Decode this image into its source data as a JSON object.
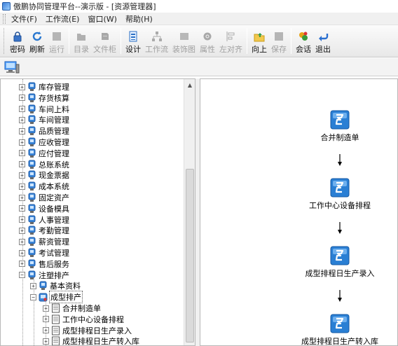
{
  "window": {
    "title": "傲鹏协同管理平台--演示版 - [资源管理器]"
  },
  "menu": {
    "items": [
      "文件(F)",
      "工作流(E)",
      "窗口(W)",
      "帮助(H)"
    ]
  },
  "toolbar": {
    "buttons": [
      {
        "label": "密码",
        "icon": "lock-icon",
        "enabled": true
      },
      {
        "label": "刷新",
        "icon": "refresh-icon",
        "enabled": true
      },
      {
        "label": "运行",
        "icon": "run-icon",
        "enabled": false
      },
      {
        "label": "目录",
        "icon": "folder-icon",
        "enabled": false
      },
      {
        "label": "文件柜",
        "icon": "cabinet-icon",
        "enabled": false
      },
      {
        "label": "设计",
        "icon": "design-icon",
        "enabled": true
      },
      {
        "label": "工作流",
        "icon": "workflow-icon",
        "enabled": false
      },
      {
        "label": "装饰图",
        "icon": "decoration-icon",
        "enabled": false
      },
      {
        "label": "属性",
        "icon": "properties-icon",
        "enabled": false
      },
      {
        "label": "左对齐",
        "icon": "align-left-icon",
        "enabled": false
      },
      {
        "label": "向上",
        "icon": "up-icon",
        "enabled": true
      },
      {
        "label": "保存",
        "icon": "save-icon",
        "enabled": false
      },
      {
        "label": "会话",
        "icon": "chat-icon",
        "enabled": true
      },
      {
        "label": "退出",
        "icon": "exit-icon",
        "enabled": true
      }
    ]
  },
  "tree": {
    "top_items": [
      "库存管理",
      "存货核算",
      "车间上料",
      "车间管理",
      "品质管理",
      "应收管理",
      "应付管理",
      "总账系统",
      "现金票据",
      "成本系统",
      "固定资产",
      "设备模具",
      "人事管理",
      "考勤管理",
      "薪资管理",
      "考试管理",
      "售后服务",
      "注塑排产"
    ],
    "sub_items": [
      "基本资料",
      "成型排产"
    ],
    "leaf_items": [
      "合并制造单",
      "工作中心设备排程",
      "成型排程日生产录入",
      "成型排程日生产转入库"
    ]
  },
  "flow": {
    "nodes": [
      "合并制造单",
      "工作中心设备排程",
      "成型排程日生产录入",
      "成型排程日生产转入库"
    ]
  },
  "colors": {
    "node_blue": "#2a7fd4",
    "node_light": "#9fd0ff",
    "toolbar_bg": "#ececec"
  }
}
